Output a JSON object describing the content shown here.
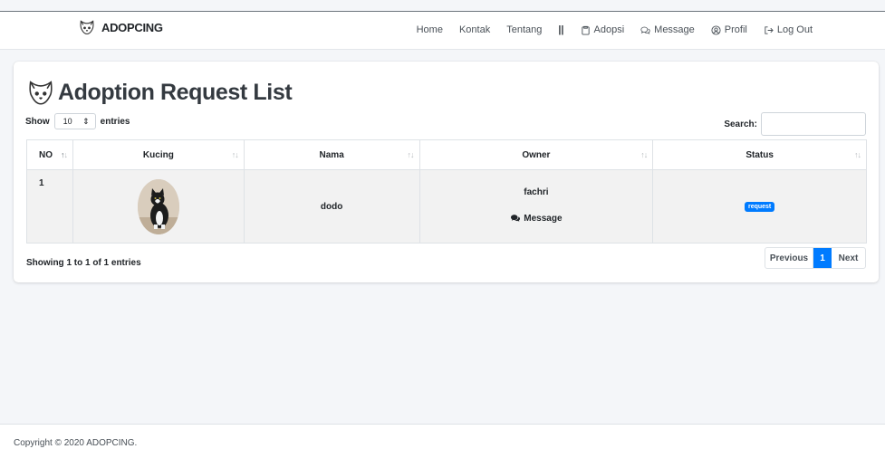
{
  "brand": {
    "name": "ADOPCING",
    "icon": "cat-face-icon"
  },
  "nav": {
    "home": "Home",
    "kontak": "Kontak",
    "tentang": "Tentang",
    "separator": "||",
    "adopsi": "Adopsi",
    "message": "Message",
    "profil": "Profil",
    "logout": "Log Out"
  },
  "page": {
    "title": "Adoption Request List",
    "show_label": "Show",
    "entries_select": "10",
    "entries_label": "entries",
    "search_label": "Search:",
    "search_value": ""
  },
  "table": {
    "headers": [
      "NO",
      "Kucing",
      "Nama",
      "Owner",
      "Status"
    ],
    "rows": [
      {
        "no": "1",
        "kucing": "cat-photo",
        "nama": "dodo",
        "owner": "fachri",
        "message_label": "Message",
        "status": "request"
      }
    ]
  },
  "pagination": {
    "info": "Showing 1 to 1 of 1 entries",
    "previous": "Previous",
    "current": "1",
    "next": "Next"
  },
  "footer": {
    "text": "Copyright © 2020 ADOPCING."
  },
  "colors": {
    "primary": "#007bff",
    "stripe": "#f2f2f2"
  }
}
